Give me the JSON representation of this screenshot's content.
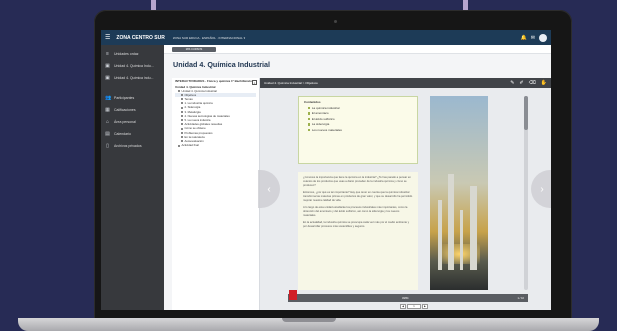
{
  "topbar": {
    "brand": "ZONA CENTRO SUR",
    "course": "ZONA SUR EDUCA · ESPAÑOL · INTERNACIONAL ▾"
  },
  "sidebar": {
    "items": [
      {
        "label": "Unidades ordaz",
        "icon": "list-icon"
      },
      {
        "label": "Unidad 4. Química Indu...",
        "icon": "book-icon"
      },
      {
        "label": "Unidad 4. Química indu...",
        "icon": "book-icon"
      },
      {
        "label": "Participantes",
        "icon": "users-icon"
      },
      {
        "label": "Calificaciones",
        "icon": "grades-icon"
      },
      {
        "label": "Área personal",
        "icon": "dashboard-icon"
      },
      {
        "label": "Calendario",
        "icon": "calendar-icon"
      },
      {
        "label": "Archivos privados",
        "icon": "file-icon"
      }
    ]
  },
  "subbar": {
    "button": "MIS CURSOS"
  },
  "page_title": "Unidad 4. Química Industrial",
  "toc": {
    "title": "INTERACTIVIDADES · Física y química 1º Bachillerato",
    "subtitle": "Unidad 4. Química Industrial",
    "rows": [
      {
        "label": "Unidad 4. Química Industrial",
        "level": 1
      },
      {
        "label": "Objetivos",
        "level": 2,
        "active": true
      },
      {
        "label": "Temas",
        "level": 2
      },
      {
        "label": "1. La industria química",
        "level": 2
      },
      {
        "label": "2. Siderurgia",
        "level": 2
      },
      {
        "label": "3. Metalurgia",
        "level": 2
      },
      {
        "label": "4. Nuevas tecnologías de materiales",
        "level": 2
      },
      {
        "label": "5. La nueva industria",
        "level": 2
      },
      {
        "label": "Actividades globales resueltas",
        "level": 2
      },
      {
        "label": "Cómo se obtiene",
        "level": 2
      },
      {
        "label": "Problemas propuestos",
        "level": 2
      },
      {
        "label": "En la naturaleza",
        "level": 2
      },
      {
        "label": "Autoevaluación",
        "level": 2
      },
      {
        "label": "Actividad final",
        "level": 1
      }
    ]
  },
  "viewer": {
    "title": "Unidad 4. Química Industrial > Objetivos",
    "contents_title": "Contenidos",
    "contents": [
      "La química industrial",
      "El amoníaco",
      "El ácido sulfúrico",
      "La siderurgia",
      "Los nuevos materiales"
    ],
    "paragraphs": [
      "¿Conoces la importancia que tiene la química en la industria? ¿Te has parado a pensar en cuántos de los productos que usas a diario proceden de la industria química y cómo se producen?",
      "Entonces, ¿por qué es tan importante? Hay que tener en cuenta que la química industrial transforma las materias primas en productos de gran valor, y que su desarrollo ha permitido mejorar nuestra calidad de vida.",
      "A lo largo de esta unidad estudiarás los procesos industriales más importantes, como la obtención del amoníaco y del ácido sulfúrico, así como la siderurgia y los nuevos materiales.",
      "En la actualidad, la industria química se preocupa cada vez más por el medio ambiente y por desarrollar procesos más sostenibles y seguros."
    ],
    "footer_center": "49/54",
    "footer_page": "1 / 10",
    "pager": [
      "◀",
      "1",
      "▶"
    ]
  }
}
